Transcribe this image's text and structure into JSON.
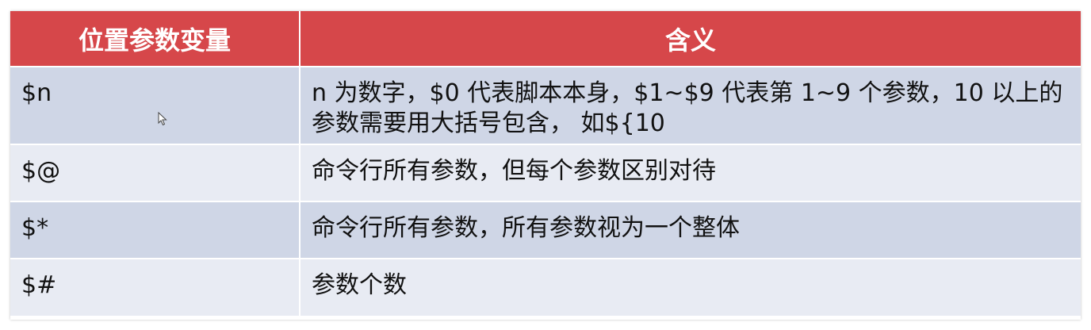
{
  "table": {
    "headers": [
      "位置参数变量",
      "含义"
    ],
    "rows": [
      {
        "var": "$n",
        "meaning": "n 为数字，$0 代表脚本本身，$1~$9 代表第 1~9 个参数，10 以上的参数需要用大括号包含， 如${10"
      },
      {
        "var": "$@",
        "meaning": "命令行所有参数，但每个参数区别对待"
      },
      {
        "var": "$*",
        "meaning": "命令行所有参数，所有参数视为一个整体"
      },
      {
        "var": "$#",
        "meaning": "参数个数"
      }
    ]
  },
  "colors": {
    "header_bg": "#d6474a",
    "row_dark": "#cfd6e6",
    "row_light": "#e8ebf3"
  },
  "icons": [
    "mouse-cursor-icon"
  ]
}
